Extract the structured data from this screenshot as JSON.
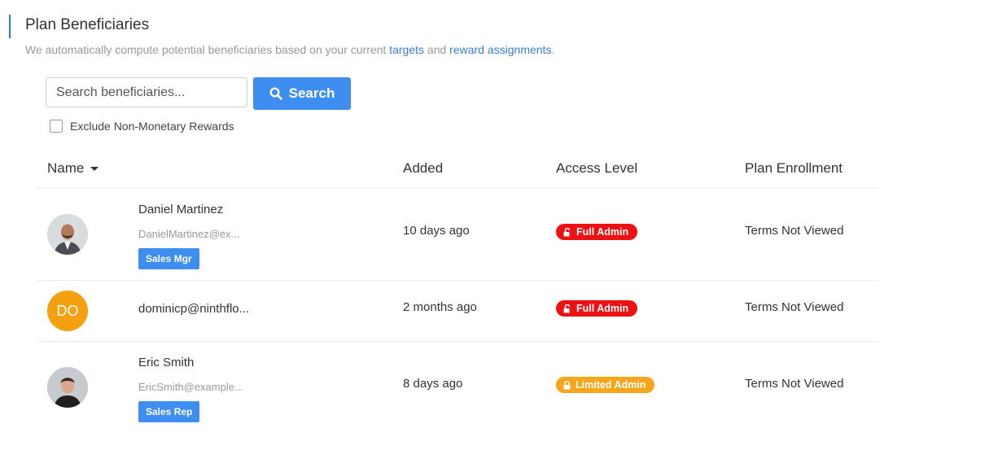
{
  "header": {
    "title": "Plan Beneficiaries",
    "subtitle_prefix": "We automatically compute potential beneficiaries based on your current ",
    "link_targets": "targets",
    "subtitle_and": " and ",
    "link_rewards": "reward assignments",
    "subtitle_suffix": "."
  },
  "search": {
    "placeholder": "Search beneficiaries...",
    "value": "",
    "button_label": "Search",
    "exclude_label": "Exclude Non-Monetary Rewards",
    "exclude_checked": false
  },
  "table": {
    "columns": [
      "Name",
      "Added",
      "Access Level",
      "Plan Enrollment"
    ],
    "rows": [
      {
        "name": "Daniel Martinez",
        "email": "DanielMartinez@ex...",
        "role": "Sales Mgr",
        "added": "10 days ago",
        "access": "Full Admin",
        "enrollment": "Terms Not Viewed",
        "avatar": "photo"
      },
      {
        "name": "dominicp@ninthflo...",
        "initials": "DO",
        "added": "2 months ago",
        "access": "Full Admin",
        "enrollment": "Terms Not Viewed",
        "avatar": "initials"
      },
      {
        "name": "Eric Smith",
        "email": "EricSmith@example...",
        "role": "Sales Rep",
        "added": "8 days ago",
        "access": "Limited Admin",
        "enrollment": "Terms Not Viewed",
        "avatar": "photo"
      }
    ]
  },
  "colors": {
    "accent": "#3d8ef0",
    "full_admin": "#ee1111",
    "limited_admin": "#f7a51a",
    "initials_avatar": "#f5a10f"
  }
}
